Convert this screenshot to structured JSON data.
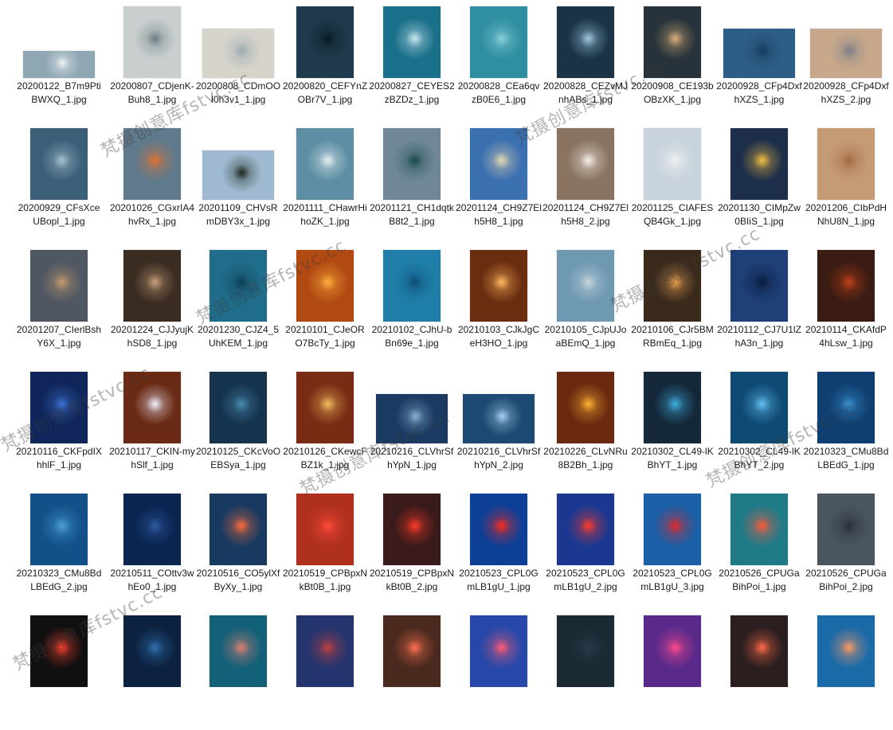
{
  "files": [
    [
      "20200122_B7m9PtiBWXQ_1.jpg",
      "20200807_CDjenK-Buh8_1.jpg",
      "20200808_CDmOOI0h3v1_1.jpg",
      "20200820_CEFYnZOBr7V_1.jpg",
      "20200827_CEYES2zBZDz_1.jpg",
      "20200828_CEa6qvzB0E6_1.jpg",
      "20200828_CEZvMJnhABs_1.jpg",
      "20200908_CE193bOBzXK_1.jpg",
      "20200928_CFp4DxfhXZS_1.jpg",
      "20200928_CFp4DxfhXZS_2.jpg"
    ],
    [
      "20200929_CFsXceUBopl_1.jpg",
      "20201026_CGxrIA4hvRx_1.jpg",
      "20201109_CHVsRmDBY3x_1.jpg",
      "20201111_CHawrHihoZK_1.jpg",
      "20201121_CH1dqtkB8t2_1.jpg",
      "20201124_CH9Z7Elh5H8_1.jpg",
      "20201124_CH9Z7Elh5H8_2.jpg",
      "20201125_CIAFESQB4Gk_1.jpg",
      "20201130_CIMpZw0BIiS_1.jpg",
      "20201206_CIbPdHNhU8N_1.jpg"
    ],
    [
      "20201207_CIerlBshY6X_1.jpg",
      "20201224_CJJyujKhSD8_1.jpg",
      "20201230_CJZ4_5UhKEM_1.jpg",
      "20210101_CJeORO7BcTy_1.jpg",
      "20210102_CJhU-bBn69e_1.jpg",
      "20210103_CJkJgCeH3HO_1.jpg",
      "20210105_CJpUJoaBEmQ_1.jpg",
      "20210106_CJr5BMRBmEq_1.jpg",
      "20210112_CJ7U1lZhA3n_1.jpg",
      "20210114_CKAfdP4hLsw_1.jpg"
    ],
    [
      "20210116_CKFpdIXhhlF_1.jpg",
      "20210117_CKIN-myhSlf_1.jpg",
      "20210125_CKcVoOEBSya_1.jpg",
      "20210126_CKewcFBZ1k_1.jpg",
      "20210216_CLVhrSfhYpN_1.jpg",
      "20210216_CLVhrSfhYpN_2.jpg",
      "20210226_CLvNRu8B2Bh_1.jpg",
      "20210302_CL49-lKBhYT_1.jpg",
      "20210302_CL49-lKBhYT_2.jpg",
      "20210323_CMu8BdLBEdG_1.jpg"
    ],
    [
      "20210323_CMu8BdLBEdG_2.jpg",
      "20210511_COttv3whEo0_1.jpg",
      "20210516_CO5ylXfByXy_1.jpg",
      "20210519_CPBpxNkBt0B_1.jpg",
      "20210519_CPBpxNkBt0B_2.jpg",
      "20210523_CPL0GmLB1gU_1.jpg",
      "20210523_CPL0GmLB1gU_2.jpg",
      "20210523_CPL0GmLB1gU_3.jpg",
      "20210526_CPUGaBihPoi_1.jpg",
      "20210526_CPUGaBihPoi_2.jpg"
    ],
    [
      "",
      "",
      "",
      "",
      "",
      "",
      "",
      "",
      "",
      ""
    ]
  ],
  "watermarks": [
    "梵摄创意库fstvc.cc",
    "梵摄创意库fstvc.cc",
    "梵摄创意库fstvc.cc",
    "梵摄创意库fstvc.cc",
    "梵摄创意库fstvc.cc",
    "梵摄创意库fstvc.cc",
    "梵摄创意库fstvc.cc",
    "梵摄创意库fstvc.cc"
  ],
  "thumb_colors": [
    [
      "#8fa7b3",
      "#c9cfcf",
      "#d6d3cb",
      "#1f3a4c",
      "#1a6f8a",
      "#2f8fa0",
      "#1a3346",
      "#27323a",
      "#2d5e86",
      "#c8a88a"
    ],
    [
      "#3c5f78",
      "#5f7a8c",
      "#9fbad0",
      "#5d8ea4",
      "#6f8797",
      "#3a6fb0",
      "#8a7461",
      "#c8d3dd",
      "#1d2e4a",
      "#c59b76"
    ],
    [
      "#4f5763",
      "#3b2c22",
      "#1f6d8a",
      "#b04a12",
      "#1f7fa8",
      "#6b2d10",
      "#6f98b2",
      "#3a2a1c",
      "#1e3f78",
      "#3a1c12"
    ],
    [
      "#10265a",
      "#6a2a14",
      "#15334d",
      "#7a2b14",
      "#1a3a62",
      "#1c4a72",
      "#6b2a10",
      "#14283a",
      "#0e4a74",
      "#0f3f70"
    ],
    [
      "#13508a",
      "#0b2450",
      "#183a60",
      "#b0301e",
      "#3a1a1a",
      "#0d3f96",
      "#1a3890",
      "#1b5fa6",
      "#1f7a88",
      "#4a5560"
    ],
    [
      "#101010",
      "#0c2240",
      "#136079",
      "#24346e",
      "#4a2a1e",
      "#2748a8",
      "#1a2a34",
      "#5a2a8a",
      "#2a1e1e",
      "#1a6aa8"
    ]
  ],
  "thumb_accents": [
    [
      "#eef3f5",
      "#6d7f84",
      "#9aa9b0",
      "#0a1a24",
      "#cbe8f0",
      "#8ad0dc",
      "#a0c8e0",
      "#d9b07a",
      "#183a60",
      "#7a7f8a"
    ],
    [
      "#a6c0d0",
      "#e07030",
      "#1e2a20",
      "#e8f0f2",
      "#1a4a4a",
      "#e8d8b0",
      "#f4f0e8",
      "#f0f0f0",
      "#f6c040",
      "#a06a40"
    ],
    [
      "#c29a6c",
      "#c7a07a",
      "#0e3f58",
      "#ffb040",
      "#0e4f78",
      "#ffb860",
      "#c8d6de",
      "#e8a050",
      "#0a1a3a",
      "#c2401a"
    ],
    [
      "#3a6fd0",
      "#f0f0ff",
      "#4a8ab0",
      "#f0c060",
      "#88b0d0",
      "#aad0f0",
      "#ffb030",
      "#3fb0e0",
      "#64c0f0",
      "#3a8fd0"
    ],
    [
      "#4aa0d8",
      "#2c5aa0",
      "#ff6a3a",
      "#ff4a3a",
      "#ff3a2a",
      "#ff2a1a",
      "#ff3a2a",
      "#e02a2a",
      "#ff5a3a",
      "#2a3038"
    ],
    [
      "#ff4030",
      "#3070b0",
      "#e08070",
      "#c04040",
      "#ff7050",
      "#ff5a70",
      "#2a3a48",
      "#ff4a8a",
      "#ff6a4a",
      "#ff9a60"
    ]
  ]
}
